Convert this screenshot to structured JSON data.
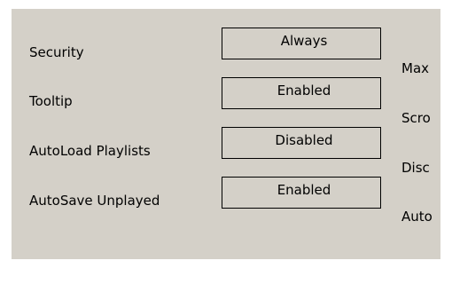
{
  "settings": {
    "rows": [
      {
        "label": "Security",
        "value": "Always"
      },
      {
        "label": "Tooltip",
        "value": "Enabled"
      },
      {
        "label": "AutoLoad Playlists",
        "value": "Disabled"
      },
      {
        "label": "AutoSave Unplayed",
        "value": "Enabled"
      }
    ],
    "right_column": [
      "Max",
      "Scro",
      "Disc",
      "Auto"
    ]
  },
  "colors": {
    "panel_background": "#d4d0c8",
    "page_background": "#ffffff",
    "separator": "#6e6e6e"
  }
}
